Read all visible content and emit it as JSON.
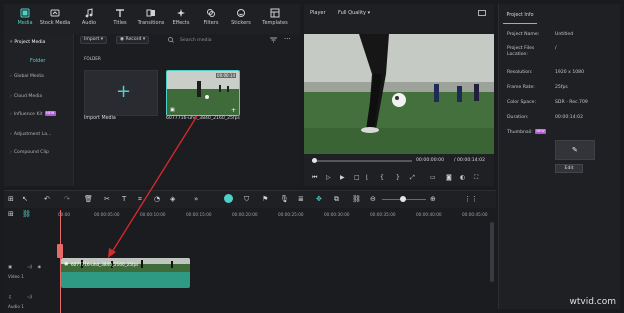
{
  "toolbar": {
    "items": [
      {
        "label": "Media",
        "icon": "media-icon",
        "active": true
      },
      {
        "label": "Stock Media",
        "icon": "stock-media-icon",
        "active": false
      },
      {
        "label": "Audio",
        "icon": "audio-icon",
        "active": false
      },
      {
        "label": "Titles",
        "icon": "titles-icon",
        "active": false
      },
      {
        "label": "Transitions",
        "icon": "transitions-icon",
        "active": false
      },
      {
        "label": "Effects",
        "icon": "effects-icon",
        "active": false
      },
      {
        "label": "Filters",
        "icon": "filters-icon",
        "active": false
      },
      {
        "label": "Stickers",
        "icon": "stickers-icon",
        "active": false
      },
      {
        "label": "Templates",
        "icon": "templates-icon",
        "active": false
      }
    ]
  },
  "sidebar": {
    "items": [
      {
        "label": "Project Media"
      },
      {
        "label": "Global Media"
      },
      {
        "label": "Cloud Media"
      },
      {
        "label": "Influence Kit",
        "badge": "NEW"
      },
      {
        "label": "Adjustment La..."
      },
      {
        "label": "Compound Clip"
      }
    ],
    "folder_label": "Folder"
  },
  "media": {
    "import_dropdown": "Import",
    "record_dropdown": "Record",
    "search_placeholder": "Search media",
    "folder_heading": "FOLDER",
    "import_card_label": "Import Media",
    "clip_label": "6077716-uhd_3840_2160_25fps",
    "clip_duration": "00:00:14"
  },
  "player": {
    "label": "Player",
    "quality": "Full Quality",
    "current_time": "00:00:00:00",
    "total_time": "/ 00:00:14:02"
  },
  "project_info": {
    "tab": "Project Info",
    "rows": [
      {
        "key": "Project Name:",
        "value": "Untitled"
      },
      {
        "key": "Project Files Location:",
        "value": "/"
      },
      {
        "key": "Resolution:",
        "value": "1920 x 1080"
      },
      {
        "key": "Frame Rate:",
        "value": "25fps"
      },
      {
        "key": "Color Space:",
        "value": "SDR - Rec.709"
      },
      {
        "key": "Duration:",
        "value": "00:00:14:02"
      }
    ],
    "thumbnail_label": "Thumbnail:",
    "thumbnail_badge": "NEW",
    "edit_button": "Edit"
  },
  "timeline": {
    "ruler": [
      "00:00",
      "00:00:05:00",
      "00:00:10:00",
      "00:00:15:00",
      "00:00:20:00",
      "00:00:25:00",
      "00:00:30:00",
      "00:00:35:00",
      "00:00:40:00",
      "00:00:45:00"
    ],
    "video_track_label": "Video 1",
    "audio_track_label": "Audio 1",
    "clip_name": "6077716-uhd_3840_2160_25fps"
  },
  "watermark": "wtvid.com",
  "colors": {
    "accent": "#4fd1c7",
    "arrow": "#d9292c",
    "panel": "#1f2024",
    "clip": "#2f9a84"
  }
}
